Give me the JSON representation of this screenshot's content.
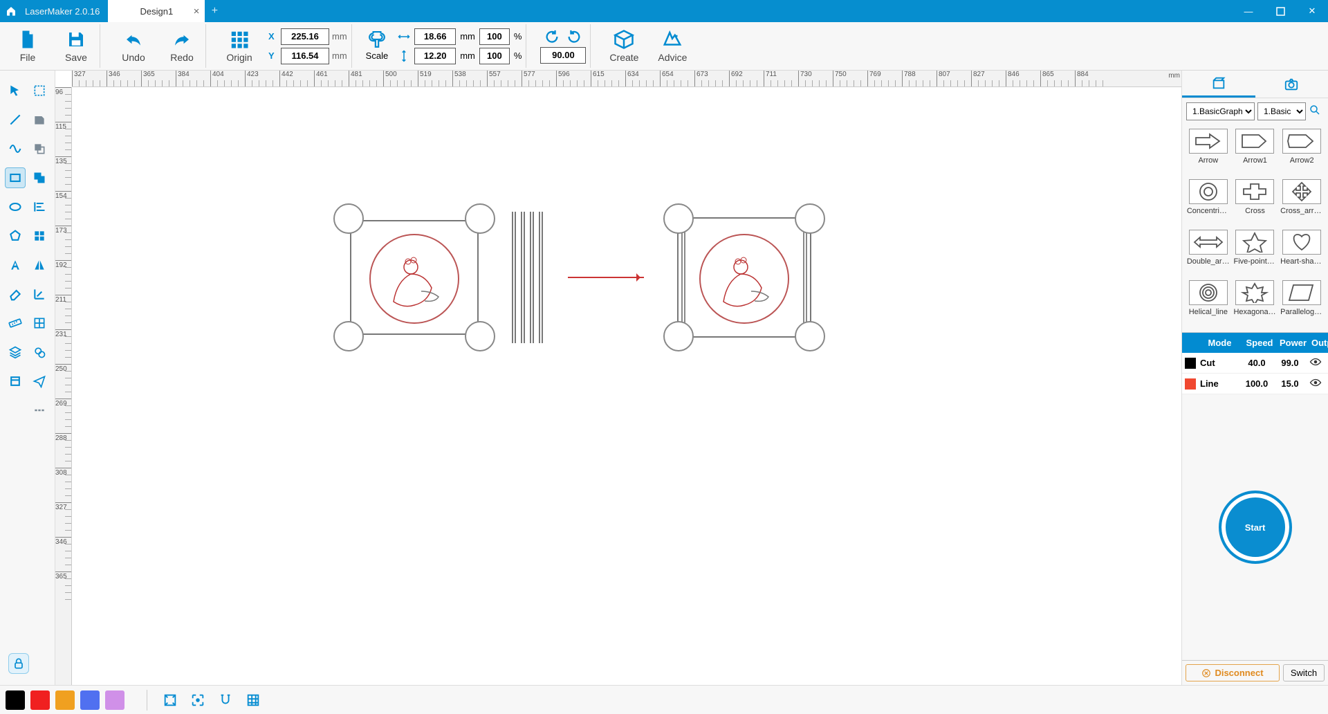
{
  "app": {
    "title": "LaserMaker 2.0.16"
  },
  "tabs": [
    {
      "label": "Design1"
    }
  ],
  "toolbar": {
    "file": "File",
    "save": "Save",
    "undo": "Undo",
    "redo": "Redo",
    "origin": "Origin",
    "x_label": "X",
    "x_val": "225.16",
    "y_label": "Y",
    "y_val": "116.54",
    "mm": "mm",
    "scale": "Scale",
    "w_val": "18.66",
    "h_val": "12.20",
    "w_pct": "100",
    "h_pct": "100",
    "pct": "%",
    "rot_val": "90.00",
    "create": "Create",
    "advice": "Advice"
  },
  "ruler": {
    "h": [
      "327",
      "346",
      "365",
      "384",
      "404",
      "423",
      "442",
      "461",
      "481",
      "500",
      "519",
      "538",
      "557",
      "577",
      "596",
      "615",
      "634",
      "654",
      "673",
      "692",
      "711",
      "730",
      "750",
      "769",
      "788",
      "807",
      "827",
      "846",
      "865",
      "884"
    ],
    "unit": "mm",
    "v": [
      "96",
      "115",
      "135",
      "154",
      "173",
      "192",
      "211",
      "231",
      "250",
      "269",
      "288",
      "308",
      "327",
      "346",
      "365"
    ]
  },
  "right": {
    "cat1": "1.BasicGraph",
    "cat2": "1.Basic",
    "shapes": [
      {
        "name": "Arrow"
      },
      {
        "name": "Arrow1"
      },
      {
        "name": "Arrow2"
      },
      {
        "name": "Concentric_..."
      },
      {
        "name": "Cross"
      },
      {
        "name": "Cross_arrow"
      },
      {
        "name": "Double_arrow"
      },
      {
        "name": "Five-pointe..."
      },
      {
        "name": "Heart-shaped"
      },
      {
        "name": "Helical_line"
      },
      {
        "name": "Hexagonal_..."
      },
      {
        "name": "Parallelogram"
      }
    ],
    "layer_headers": {
      "mode": "Mode",
      "speed": "Speed",
      "power": "Power",
      "output": "Output"
    },
    "layers": [
      {
        "color": "#000000",
        "mode": "Cut",
        "speed": "40.0",
        "power": "99.0"
      },
      {
        "color": "#f04830",
        "mode": "Line",
        "speed": "100.0",
        "power": "15.0"
      }
    ],
    "start": "Start",
    "disconnect": "Disconnect",
    "switch": "Switch"
  },
  "bottom": {
    "colors": [
      "#000000",
      "#f02020",
      "#f0a020",
      "#5070f0",
      "#d090e8"
    ]
  }
}
